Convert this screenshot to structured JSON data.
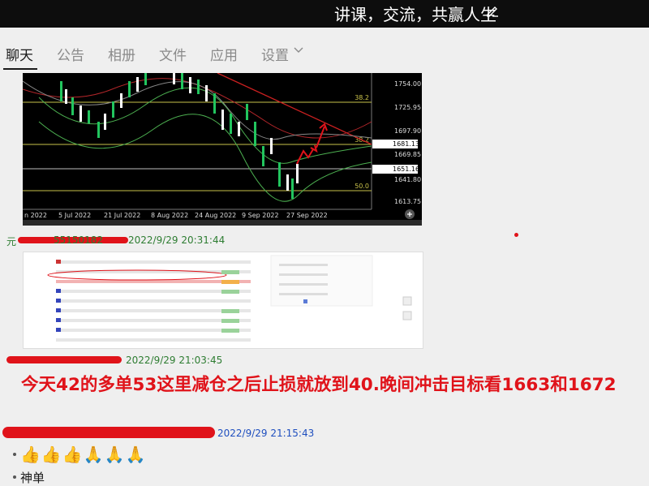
{
  "header": {
    "title": "讲课，交流，共赢人生"
  },
  "tabs": [
    {
      "label": "聊天",
      "active": true
    },
    {
      "label": "公告"
    },
    {
      "label": "相册"
    },
    {
      "label": "文件"
    },
    {
      "label": "应用"
    },
    {
      "label": "设置"
    }
  ],
  "chart": {
    "price_labels": [
      "1754.00",
      "1725.95",
      "1697.90",
      "1669.85",
      "1641.80",
      "1613.75"
    ],
    "date_labels": [
      "n 2022",
      "5 Jul 2022",
      "21 Jul 2022",
      "8 Aug 2022",
      "24 Aug 2022",
      "9 Sep 2022",
      "27 Sep 2022"
    ],
    "level_tags": {
      "fib1": "38.2",
      "fib2": "38.2",
      "fib3": "50.0"
    },
    "price_tags": {
      "top": "1681.13",
      "bottom": "1651.16"
    }
  },
  "messages": [
    {
      "sender": "元",
      "id": "55150182",
      "time": "2022/9/29 20:31:44"
    },
    {
      "sender": "",
      "id": "",
      "time": "2022/9/29 21:03:45",
      "text": "今天42的多单53这里减仓之后止损就放到40.晚间冲击目标看1663和1672"
    },
    {
      "sender": "",
      "time": "2022/9/29 21:15:43"
    }
  ],
  "reactions": "👍👍👍🙏🙏🙏",
  "last_message": "神单",
  "colors": {
    "accent_red": "#e0131a",
    "time_green": "#2e7d32",
    "time_blue": "#1f4fbf"
  }
}
